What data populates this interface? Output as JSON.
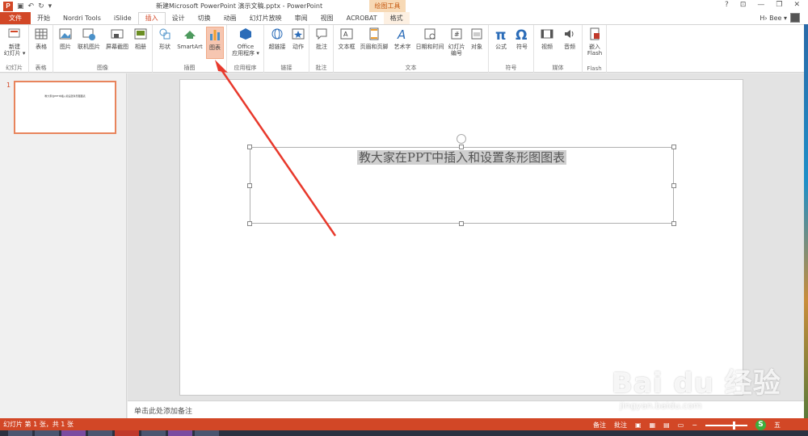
{
  "window": {
    "title": "新建Microsoft PowerPoint 演示文稿.pptx - PowerPoint",
    "context_group": "绘图工具",
    "controls": [
      "?",
      "⊡",
      "—",
      "❐",
      "✕"
    ]
  },
  "qat": {
    "logo": "P",
    "save": "▣",
    "undo": "↶",
    "redo": "↻",
    "customize": "▾"
  },
  "tabs": [
    "文件",
    "开始",
    "Nordri Tools",
    "iSlide",
    "插入",
    "设计",
    "切换",
    "动画",
    "幻灯片放映",
    "审阅",
    "视图",
    "ACROBAT",
    "格式"
  ],
  "active_tab": "插入",
  "user": {
    "name": "H› Bee ▾"
  },
  "ribbon": {
    "groups": {
      "slides": "幻灯片",
      "tables": "表格",
      "images": "图像",
      "illustrations": "插图",
      "apps": "应用程序",
      "links": "链接",
      "comments": "批注",
      "text": "文本",
      "symbols": "符号",
      "media": "媒体",
      "flash": "Flash"
    },
    "buttons": {
      "new_slide_1": "新建",
      "new_slide_2": "幻灯片 ▾",
      "table": "表格",
      "picture": "图片",
      "online_picture": "联机图片",
      "screenshot": "屏幕截图",
      "album": "相册",
      "shapes": "形状",
      "smartart": "SmartArt",
      "chart": "图表",
      "office_apps_1": "Office",
      "office_apps_2": "应用程序 ▾",
      "hyperlink": "超链接",
      "action": "动作",
      "comment": "批注",
      "textbox": "文本框",
      "header_footer": "页眉和页脚",
      "wordart": "艺术字",
      "datetime": "日期和时间",
      "slide_number_1": "幻灯片",
      "slide_number_2": "编号",
      "object": "对象",
      "equation": "公式",
      "symbol": "符号",
      "video": "视频",
      "audio": "音频",
      "embed_1": "嵌入",
      "embed_2": "Flash"
    }
  },
  "thumbnail": {
    "number": "1",
    "text": "教大家在PPT中插入和设置条形图图表"
  },
  "slide": {
    "title": "教大家在PPT中插入和设置条形图图表"
  },
  "notes": {
    "placeholder": "单击此处添加备注"
  },
  "status": {
    "slide_info": "幻灯片 第 1 张，共 1 张",
    "notes_btn": "备注",
    "comments_btn": "批注",
    "badge": "S",
    "ime": "五"
  },
  "watermark": {
    "logo": "Bai du 经验",
    "url": "jingyan.baidu.com"
  },
  "colors": {
    "accent": "#d24726",
    "highlight": "#f6c6b1",
    "arrow": "#e8392c"
  }
}
